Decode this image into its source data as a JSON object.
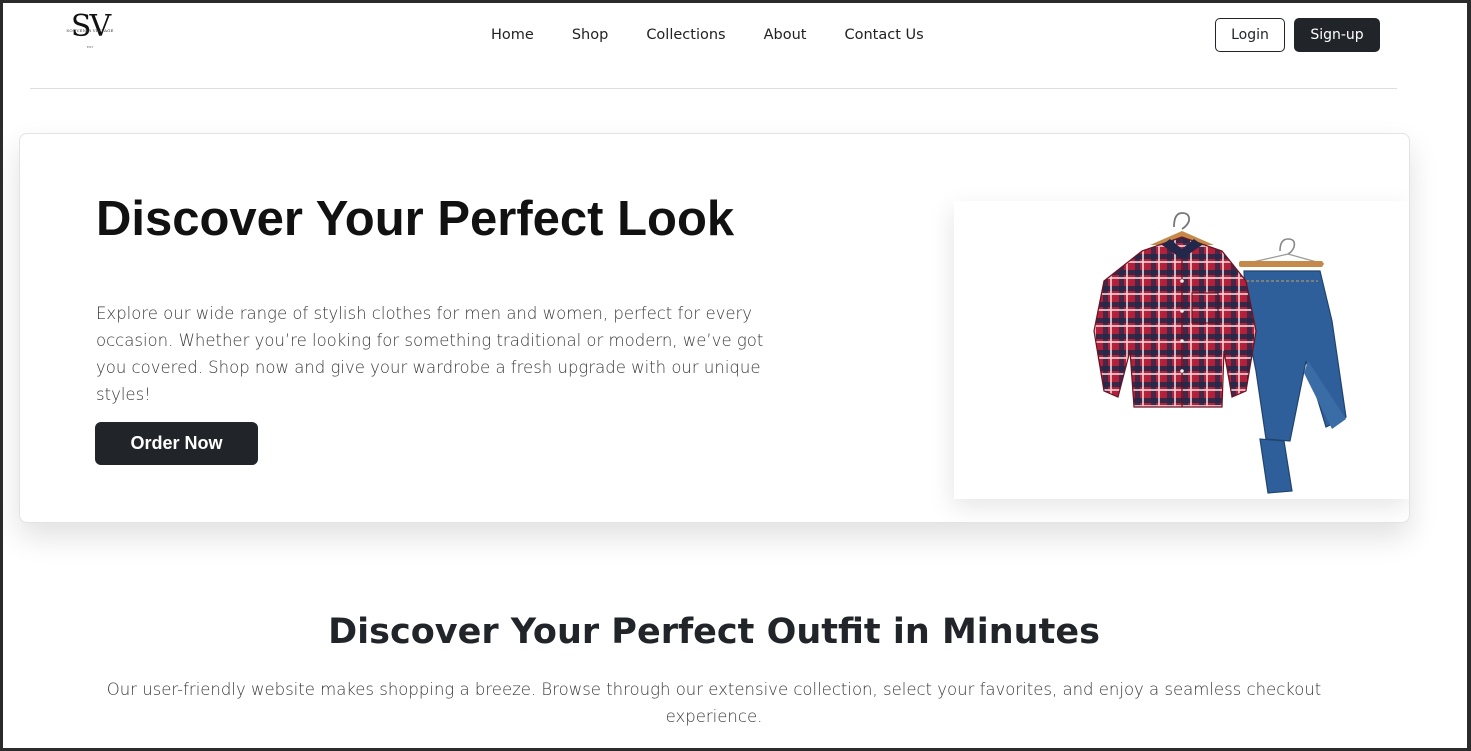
{
  "brand": {
    "logo_mark": "SV",
    "logo_sub": "SOUVENIR VINTAGE",
    "logo_tag": "EST"
  },
  "nav": {
    "links": [
      "Home",
      "Shop",
      "Collections",
      "About",
      "Contact Us"
    ],
    "login_label": "Login",
    "signup_label": "Sign-up"
  },
  "hero": {
    "title": "Discover Your Perfect Look",
    "description": "Explore our wide range of stylish clothes for men and women, perfect for every occasion. Whether you’re looking for something traditional or modern, we’ve got you covered. Shop now and give your wardrobe a fresh upgrade with our unique styles!",
    "cta_label": "Order Now",
    "image": "plaid-shirt-and-jeans-on-hangers"
  },
  "section": {
    "title": "Discover Your Perfect Outfit in Minutes",
    "description": "Our user-friendly website makes shopping a breeze. Browse through our extensive collection, select your favorites, and enjoy a seamless checkout experience."
  },
  "colors": {
    "primary_dark": "#212529",
    "background": "#ffffff",
    "shirt_red": "#b3203a",
    "shirt_navy": "#23284a",
    "denim": "#2f5f9a"
  }
}
